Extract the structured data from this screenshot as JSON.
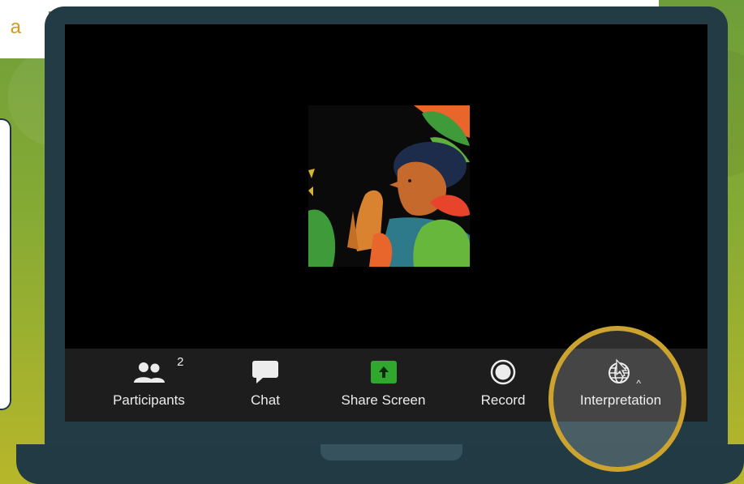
{
  "caption": {
    "text": "a"
  },
  "toolbar": {
    "participants": {
      "label": "Participants",
      "count": "2",
      "icon": "participants-icon"
    },
    "chat": {
      "label": "Chat",
      "icon": "chat-bubble-icon"
    },
    "share": {
      "label": "Share Screen",
      "icon": "share-screen-icon"
    },
    "record": {
      "label": "Record",
      "icon": "record-icon"
    },
    "interpretation": {
      "label": "Interpretation",
      "icon": "globe-icon",
      "caret": "^"
    }
  },
  "colors": {
    "background_green": "#86ab34",
    "laptop_frame": "#233b45",
    "toolbar_bg": "#1d1d1d",
    "share_green": "#2fa82d",
    "highlight_ring": "#cda330",
    "caption_text": "#d19b1d"
  }
}
